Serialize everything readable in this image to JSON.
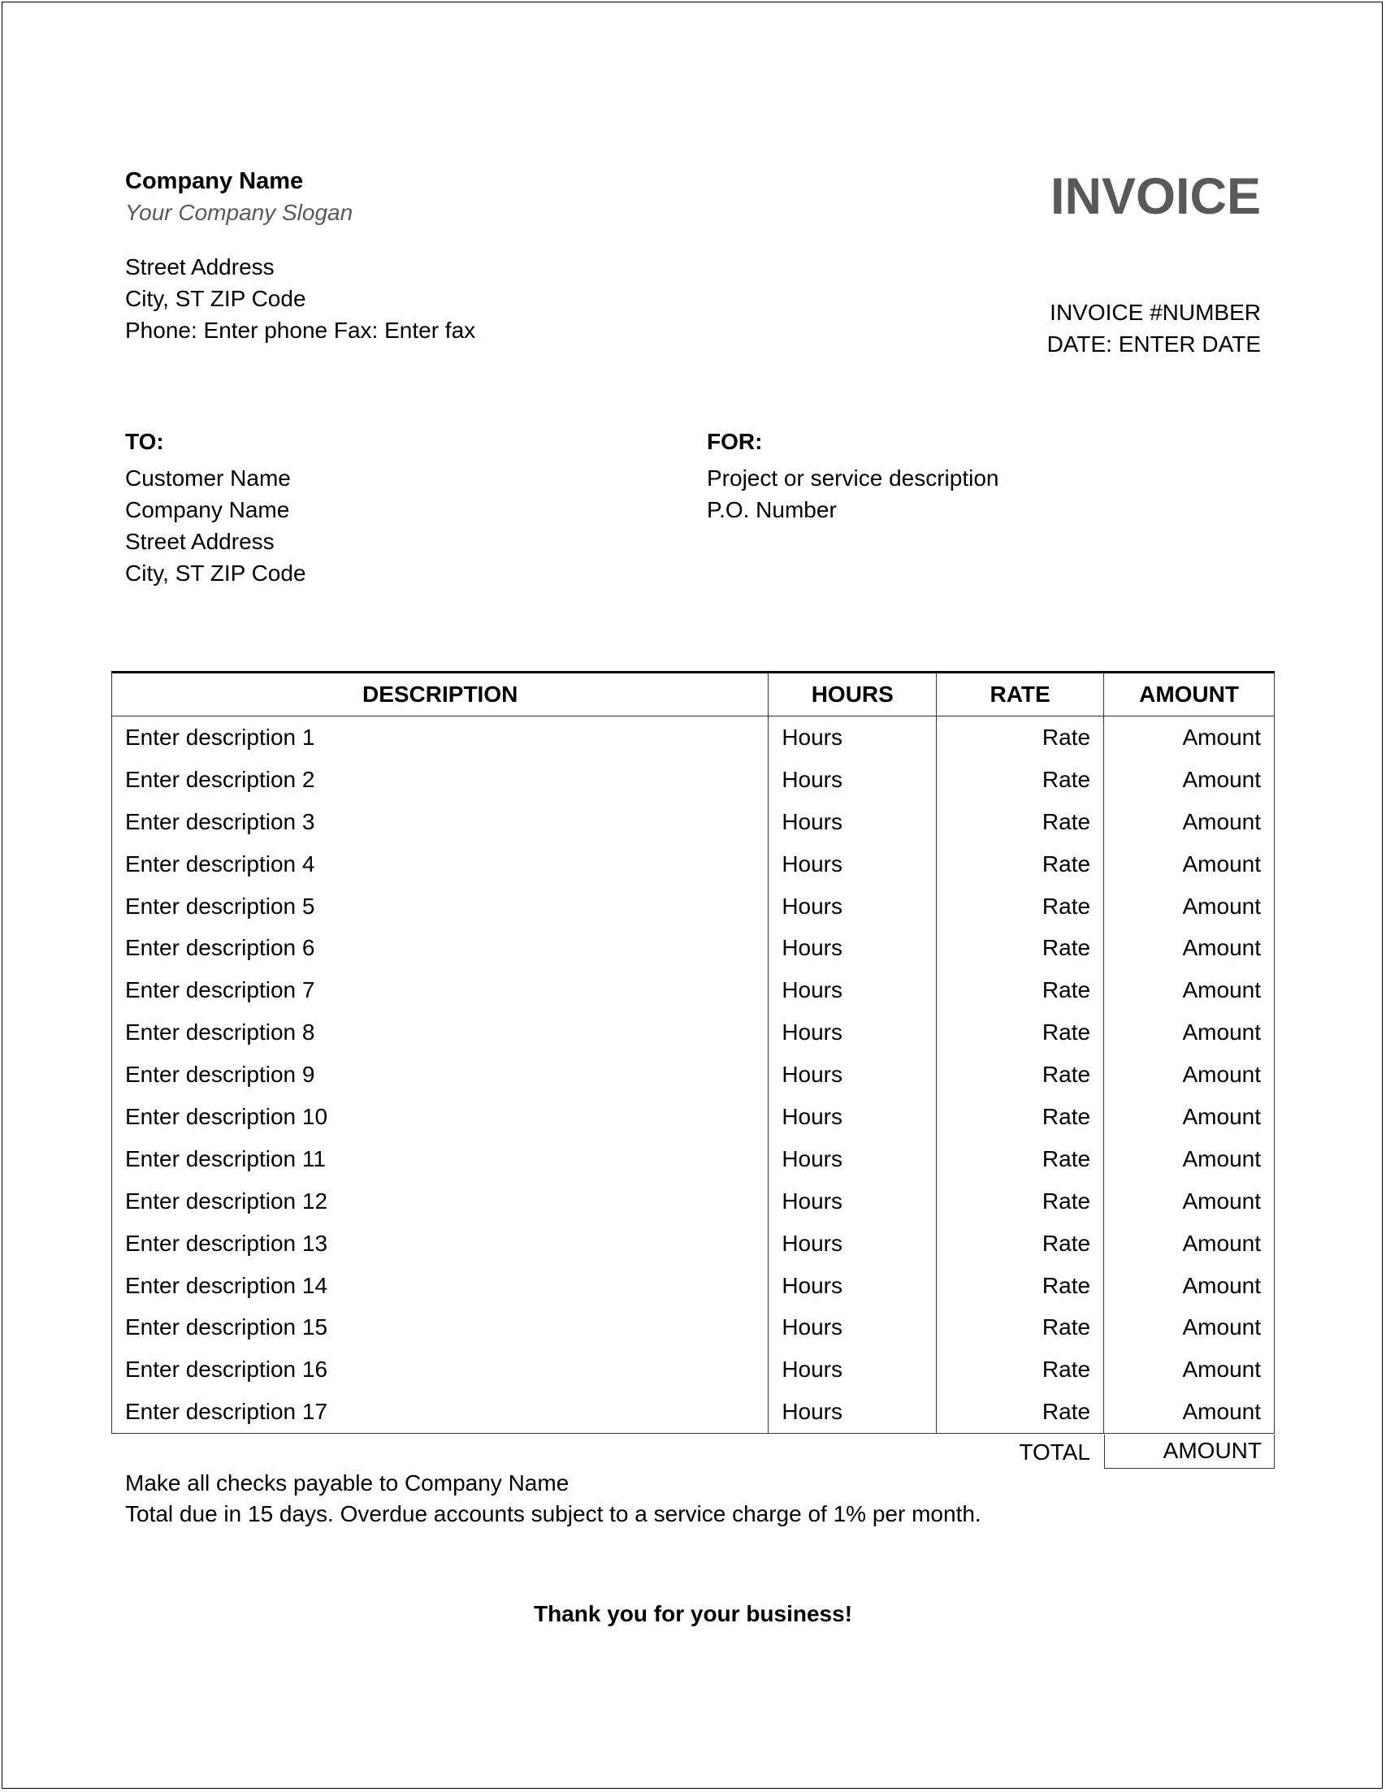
{
  "company": {
    "name": "Company Name",
    "slogan": "Your Company Slogan",
    "address_lines": [
      "Street Address",
      "City, ST ZIP Code",
      "Phone: Enter phone Fax: Enter fax"
    ]
  },
  "invoice": {
    "title": "INVOICE",
    "number": "INVOICE #NUMBER",
    "date": "DATE: ENTER DATE"
  },
  "bill_to": {
    "label": "TO:",
    "lines": [
      "Customer Name",
      "Company Name",
      "Street Address",
      "City, ST ZIP Code"
    ]
  },
  "for": {
    "label": "FOR:",
    "lines": [
      "Project or service description",
      "P.O. Number"
    ]
  },
  "table": {
    "headers": [
      "DESCRIPTION",
      "HOURS",
      "RATE",
      "AMOUNT"
    ],
    "rows": [
      {
        "description": "Enter description 1",
        "hours": "Hours",
        "rate": "Rate",
        "amount": "Amount"
      },
      {
        "description": "Enter description 2",
        "hours": "Hours",
        "rate": "Rate",
        "amount": "Amount"
      },
      {
        "description": "Enter description 3",
        "hours": "Hours",
        "rate": "Rate",
        "amount": "Amount"
      },
      {
        "description": "Enter description 4",
        "hours": "Hours",
        "rate": "Rate",
        "amount": "Amount"
      },
      {
        "description": "Enter description 5",
        "hours": "Hours",
        "rate": "Rate",
        "amount": "Amount"
      },
      {
        "description": "Enter description 6",
        "hours": "Hours",
        "rate": "Rate",
        "amount": "Amount"
      },
      {
        "description": "Enter description 7",
        "hours": "Hours",
        "rate": "Rate",
        "amount": "Amount"
      },
      {
        "description": "Enter description 8",
        "hours": "Hours",
        "rate": "Rate",
        "amount": "Amount"
      },
      {
        "description": "Enter description 9",
        "hours": "Hours",
        "rate": "Rate",
        "amount": "Amount"
      },
      {
        "description": "Enter description 10",
        "hours": "Hours",
        "rate": "Rate",
        "amount": "Amount"
      },
      {
        "description": "Enter description 11",
        "hours": "Hours",
        "rate": "Rate",
        "amount": "Amount"
      },
      {
        "description": "Enter description 12",
        "hours": "Hours",
        "rate": "Rate",
        "amount": "Amount"
      },
      {
        "description": "Enter description 13",
        "hours": "Hours",
        "rate": "Rate",
        "amount": "Amount"
      },
      {
        "description": "Enter description 14",
        "hours": "Hours",
        "rate": "Rate",
        "amount": "Amount"
      },
      {
        "description": "Enter description 15",
        "hours": "Hours",
        "rate": "Rate",
        "amount": "Amount"
      },
      {
        "description": "Enter description 16",
        "hours": "Hours",
        "rate": "Rate",
        "amount": "Amount"
      },
      {
        "description": "Enter description 17",
        "hours": "Hours",
        "rate": "Rate",
        "amount": "Amount"
      }
    ],
    "total_label": "TOTAL",
    "total_value": "AMOUNT"
  },
  "notes": [
    "Make all checks payable to Company Name",
    "Total due in 15 days. Overdue accounts subject to a service charge of 1% per month."
  ],
  "thanks": "Thank you for your business!",
  "colors": {
    "title_gray": "#595959",
    "slogan_gray": "#595959",
    "text": "#000000"
  }
}
